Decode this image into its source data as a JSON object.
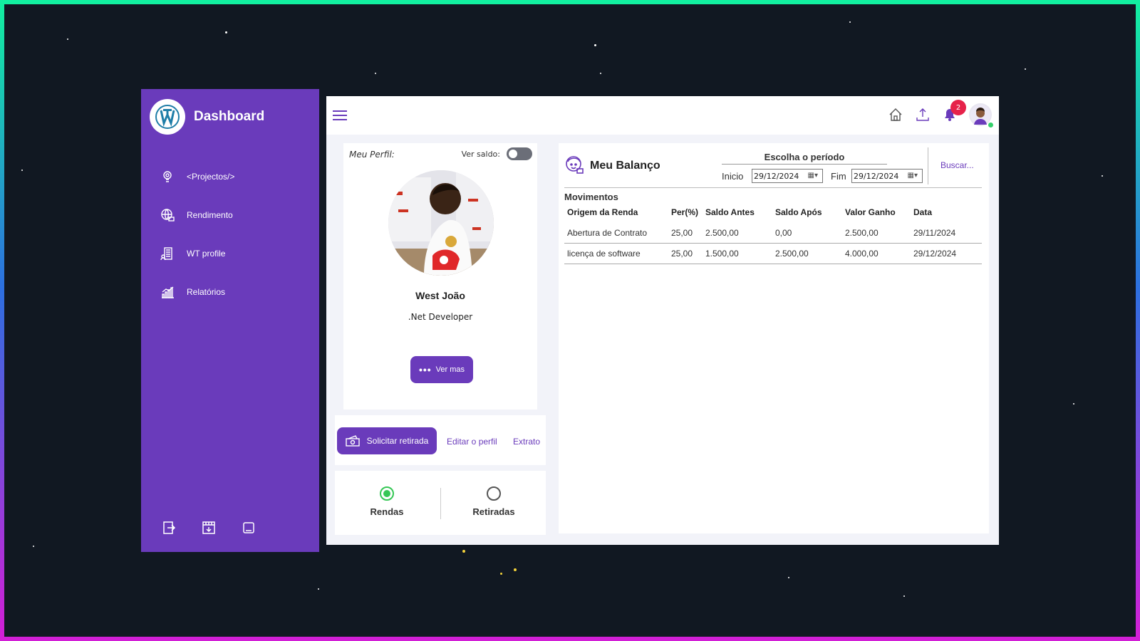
{
  "sidebar": {
    "title": "Dashboard",
    "items": [
      {
        "label": "<Projectos/>",
        "icon": "gear-bulb-icon"
      },
      {
        "label": "Rendimento",
        "icon": "money-globe-icon"
      },
      {
        "label": "WT profile",
        "icon": "building-profile-icon"
      },
      {
        "label": "Relatórios",
        "icon": "chart-icon"
      }
    ]
  },
  "topbar": {
    "notifications_count": "2"
  },
  "profile": {
    "label": "Meu Perfil:",
    "ver_saldo_label": "Ver saldo:",
    "name": "West João",
    "role": ".Net Developer",
    "ver_mas": "Ver mas"
  },
  "actions": {
    "solicitar": "Solicitar retirada",
    "editar": "Editar o perfil",
    "extrato": "Extrato"
  },
  "tabs": {
    "rendas": "Rendas",
    "retiradas": "Retiradas"
  },
  "balance": {
    "title": "Meu Balanço",
    "period_title": "Escolha o período",
    "inicio_label": "Inicio",
    "inicio_value": "29/12/2024",
    "fim_label": "Fim",
    "fim_value": "29/12/2024",
    "buscar": "Buscar...",
    "movimentos": "Movimentos",
    "columns": [
      "Origem da Renda",
      "Per(%)",
      "Saldo Antes",
      "Saldo Após",
      "Valor Ganho",
      "Data"
    ],
    "rows": [
      [
        "Abertura de Contrato",
        "25,00",
        "2.500,00",
        "0,00",
        "2.500,00",
        "29/11/2024"
      ],
      [
        "licença de software",
        "25,00",
        "1.500,00",
        "2.500,00",
        "4.000,00",
        "29/12/2024"
      ]
    ]
  },
  "colors": {
    "accent": "#6a3bbb",
    "badge": "#e6224a",
    "online": "#35d06a"
  }
}
